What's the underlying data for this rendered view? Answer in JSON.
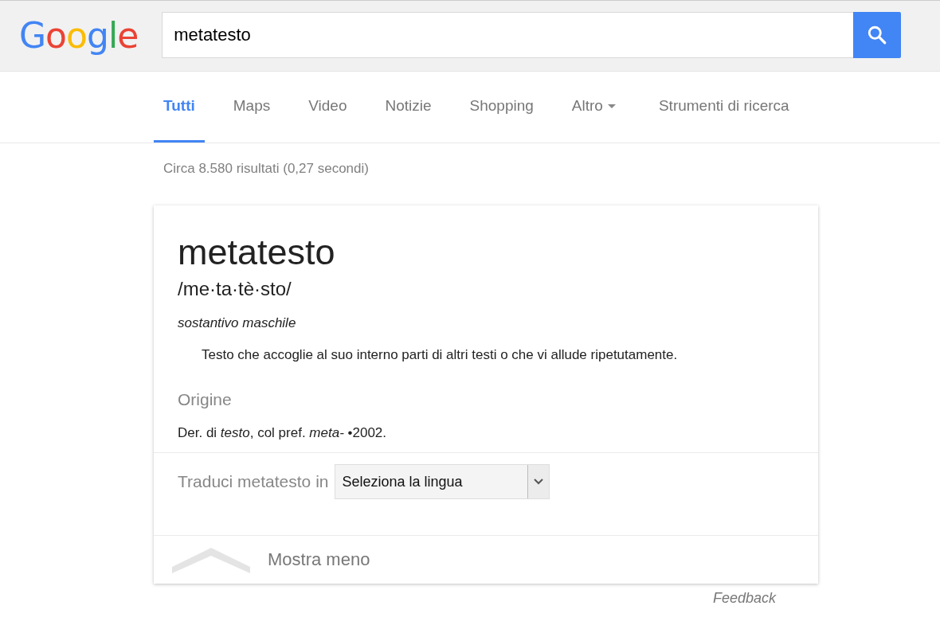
{
  "logo": "Google",
  "search": {
    "value": "metatesto"
  },
  "tabs": [
    {
      "label": "Tutti",
      "selected": true,
      "kind": "tab"
    },
    {
      "label": "Maps",
      "selected": false,
      "kind": "tab"
    },
    {
      "label": "Video",
      "selected": false,
      "kind": "tab"
    },
    {
      "label": "Notizie",
      "selected": false,
      "kind": "tab"
    },
    {
      "label": "Shopping",
      "selected": false,
      "kind": "tab"
    },
    {
      "label": "Altro",
      "selected": false,
      "kind": "dropdown"
    },
    {
      "label": "Strumenti di ricerca",
      "selected": false,
      "kind": "tool"
    }
  ],
  "result_stats": "Circa 8.580 risultati (0,27 secondi)",
  "definition": {
    "word": "metatesto",
    "pronunciation": "/me·ta·tè·sto/",
    "part_of_speech": "sostantivo maschile",
    "meaning": "Testo che accoglie al suo interno parti di altri testi o che vi allude ripetutamente.",
    "origin_heading": "Origine",
    "origin": "Der. di *testo*, col pref. *meta-* •2002."
  },
  "translate": {
    "label": "Traduci metatesto in",
    "select": "Seleziona la lingua"
  },
  "show_less": "Mostra meno",
  "feedback": "Feedback"
}
